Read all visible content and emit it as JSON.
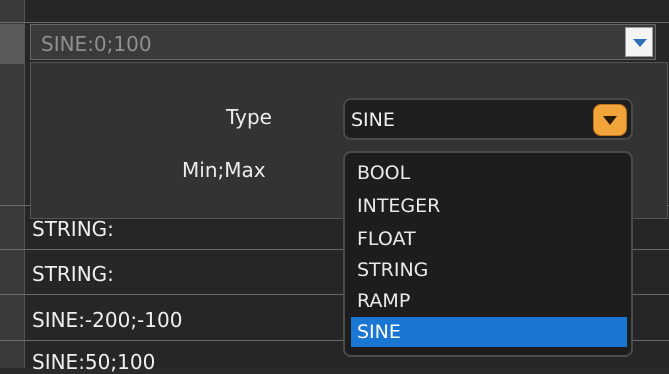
{
  "top_combo": {
    "value": "SINE:0;100"
  },
  "editor": {
    "type_label": "Type",
    "minmax_label": "Min;Max",
    "type_value": "SINE"
  },
  "dropdown": {
    "options": [
      "BOOL",
      "INTEGER",
      "FLOAT",
      "STRING",
      "RAMP",
      "SINE"
    ],
    "selected": "SINE"
  },
  "table": {
    "rows": [
      "STRING:",
      "STRING:",
      "SINE:-200;-100",
      "SINE:50;100"
    ]
  },
  "colors": {
    "selection": "#1976d2",
    "dropdown_button": "#f0a43a"
  }
}
